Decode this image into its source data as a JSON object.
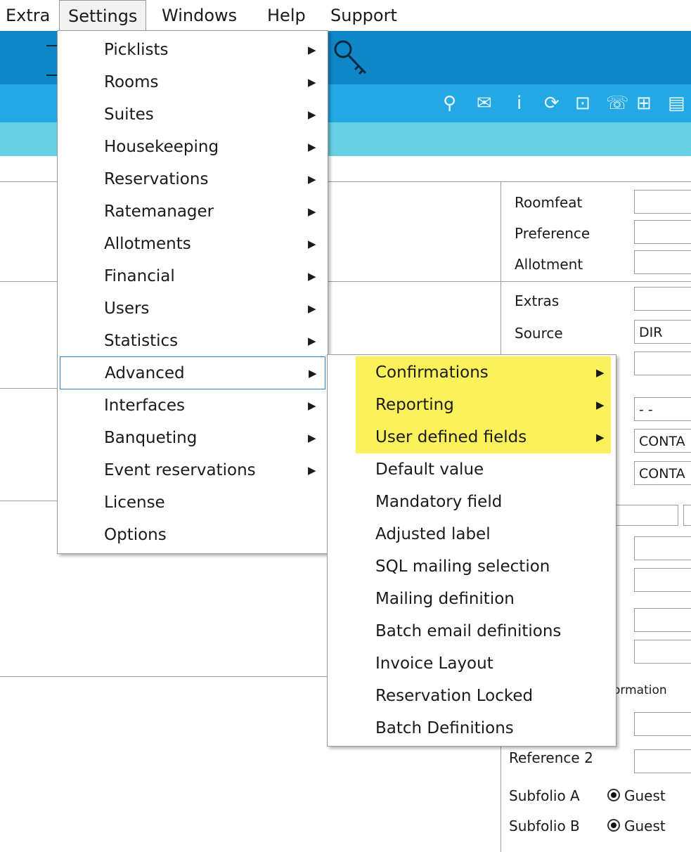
{
  "menubar": {
    "items": [
      "Extra",
      "Settings",
      "Windows",
      "Help",
      "Support"
    ]
  },
  "settings_menu": {
    "items": [
      {
        "label": "Picklists",
        "submenu": true
      },
      {
        "label": "Rooms",
        "submenu": true
      },
      {
        "label": "Suites",
        "submenu": true
      },
      {
        "label": "Housekeeping",
        "submenu": true
      },
      {
        "label": "Reservations",
        "submenu": true
      },
      {
        "label": "Ratemanager",
        "submenu": true
      },
      {
        "label": "Allotments",
        "submenu": true
      },
      {
        "label": "Financial",
        "submenu": true
      },
      {
        "label": "Users",
        "submenu": true
      },
      {
        "label": "Statistics",
        "submenu": true
      },
      {
        "label": "Advanced",
        "submenu": true,
        "active": true
      },
      {
        "label": "Interfaces",
        "submenu": true
      },
      {
        "label": "Banqueting",
        "submenu": true
      },
      {
        "label": "Event reservations",
        "submenu": true
      },
      {
        "label": "License",
        "submenu": false
      },
      {
        "label": "Options",
        "submenu": false
      }
    ]
  },
  "advanced_submenu": {
    "highlight_color": "#fbf25b",
    "items": [
      {
        "label": "Confirmations",
        "submenu": true,
        "highlighted": true
      },
      {
        "label": "Reporting",
        "submenu": true,
        "highlighted": true
      },
      {
        "label": "User defined fields",
        "submenu": true,
        "highlighted": true
      },
      {
        "label": "Default value",
        "submenu": false
      },
      {
        "label": "Mandatory field",
        "submenu": false
      },
      {
        "label": "Adjusted label",
        "submenu": false
      },
      {
        "label": "SQL mailing selection",
        "submenu": false
      },
      {
        "label": "Mailing definition",
        "submenu": false
      },
      {
        "label": "Batch email definitions",
        "submenu": false
      },
      {
        "label": "Invoice Layout",
        "submenu": false
      },
      {
        "label": "Reservation Locked",
        "submenu": false
      },
      {
        "label": "Batch Definitions",
        "submenu": false
      }
    ]
  },
  "form": {
    "roomfeat_label": "Roomfeat",
    "preference_label": "Preference",
    "allotment_label": "Allotment",
    "extras_label": "Extras",
    "source_label": "Source",
    "source_value": "DIR",
    "date_value": "- -",
    "contact1_value": "CONTA",
    "contact2_value": "CONTA",
    "information_fragment": "ormation",
    "reference2_label": "Reference 2",
    "subfolio_a_label": "Subfolio A",
    "subfolio_a_option": "Guest",
    "subfolio_b_label": "Subfolio B",
    "subfolio_b_option": "Guest"
  },
  "colors": {
    "band_dark": "#0f86c8",
    "band_mid": "#22a9e3",
    "band_light": "#66d1e4",
    "focus_border": "#2f7fd0"
  }
}
